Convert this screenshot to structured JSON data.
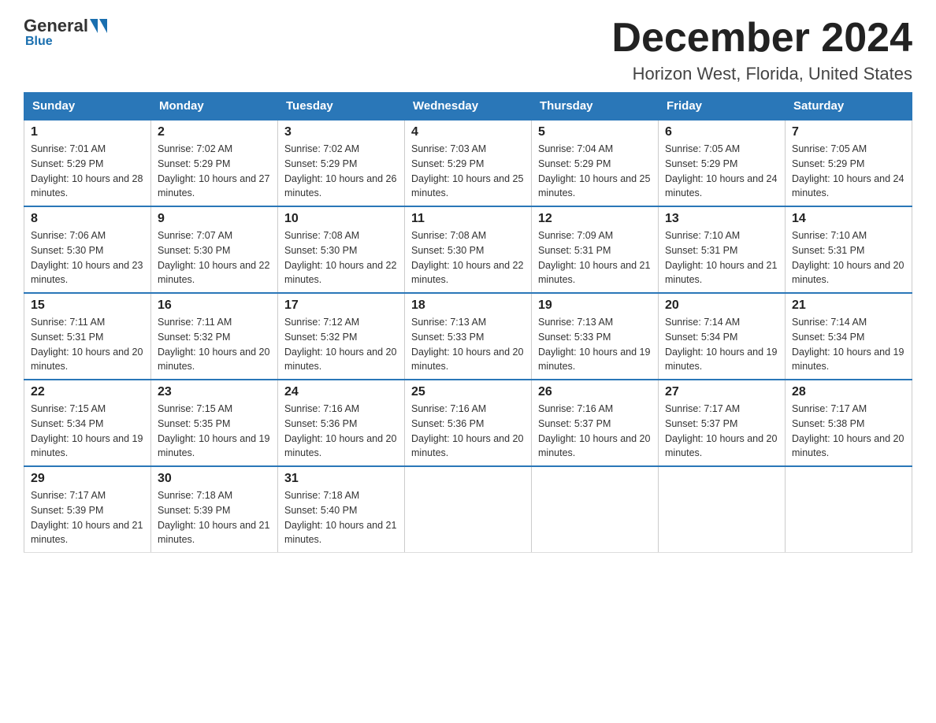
{
  "logo": {
    "general": "General",
    "blue": "Blue"
  },
  "header": {
    "month_year": "December 2024",
    "location": "Horizon West, Florida, United States"
  },
  "days_of_week": [
    "Sunday",
    "Monday",
    "Tuesday",
    "Wednesday",
    "Thursday",
    "Friday",
    "Saturday"
  ],
  "weeks": [
    [
      {
        "day": "1",
        "sunrise": "7:01 AM",
        "sunset": "5:29 PM",
        "daylight": "10 hours and 28 minutes."
      },
      {
        "day": "2",
        "sunrise": "7:02 AM",
        "sunset": "5:29 PM",
        "daylight": "10 hours and 27 minutes."
      },
      {
        "day": "3",
        "sunrise": "7:02 AM",
        "sunset": "5:29 PM",
        "daylight": "10 hours and 26 minutes."
      },
      {
        "day": "4",
        "sunrise": "7:03 AM",
        "sunset": "5:29 PM",
        "daylight": "10 hours and 25 minutes."
      },
      {
        "day": "5",
        "sunrise": "7:04 AM",
        "sunset": "5:29 PM",
        "daylight": "10 hours and 25 minutes."
      },
      {
        "day": "6",
        "sunrise": "7:05 AM",
        "sunset": "5:29 PM",
        "daylight": "10 hours and 24 minutes."
      },
      {
        "day": "7",
        "sunrise": "7:05 AM",
        "sunset": "5:29 PM",
        "daylight": "10 hours and 24 minutes."
      }
    ],
    [
      {
        "day": "8",
        "sunrise": "7:06 AM",
        "sunset": "5:30 PM",
        "daylight": "10 hours and 23 minutes."
      },
      {
        "day": "9",
        "sunrise": "7:07 AM",
        "sunset": "5:30 PM",
        "daylight": "10 hours and 22 minutes."
      },
      {
        "day": "10",
        "sunrise": "7:08 AM",
        "sunset": "5:30 PM",
        "daylight": "10 hours and 22 minutes."
      },
      {
        "day": "11",
        "sunrise": "7:08 AM",
        "sunset": "5:30 PM",
        "daylight": "10 hours and 22 minutes."
      },
      {
        "day": "12",
        "sunrise": "7:09 AM",
        "sunset": "5:31 PM",
        "daylight": "10 hours and 21 minutes."
      },
      {
        "day": "13",
        "sunrise": "7:10 AM",
        "sunset": "5:31 PM",
        "daylight": "10 hours and 21 minutes."
      },
      {
        "day": "14",
        "sunrise": "7:10 AM",
        "sunset": "5:31 PM",
        "daylight": "10 hours and 20 minutes."
      }
    ],
    [
      {
        "day": "15",
        "sunrise": "7:11 AM",
        "sunset": "5:31 PM",
        "daylight": "10 hours and 20 minutes."
      },
      {
        "day": "16",
        "sunrise": "7:11 AM",
        "sunset": "5:32 PM",
        "daylight": "10 hours and 20 minutes."
      },
      {
        "day": "17",
        "sunrise": "7:12 AM",
        "sunset": "5:32 PM",
        "daylight": "10 hours and 20 minutes."
      },
      {
        "day": "18",
        "sunrise": "7:13 AM",
        "sunset": "5:33 PM",
        "daylight": "10 hours and 20 minutes."
      },
      {
        "day": "19",
        "sunrise": "7:13 AM",
        "sunset": "5:33 PM",
        "daylight": "10 hours and 19 minutes."
      },
      {
        "day": "20",
        "sunrise": "7:14 AM",
        "sunset": "5:34 PM",
        "daylight": "10 hours and 19 minutes."
      },
      {
        "day": "21",
        "sunrise": "7:14 AM",
        "sunset": "5:34 PM",
        "daylight": "10 hours and 19 minutes."
      }
    ],
    [
      {
        "day": "22",
        "sunrise": "7:15 AM",
        "sunset": "5:34 PM",
        "daylight": "10 hours and 19 minutes."
      },
      {
        "day": "23",
        "sunrise": "7:15 AM",
        "sunset": "5:35 PM",
        "daylight": "10 hours and 19 minutes."
      },
      {
        "day": "24",
        "sunrise": "7:16 AM",
        "sunset": "5:36 PM",
        "daylight": "10 hours and 20 minutes."
      },
      {
        "day": "25",
        "sunrise": "7:16 AM",
        "sunset": "5:36 PM",
        "daylight": "10 hours and 20 minutes."
      },
      {
        "day": "26",
        "sunrise": "7:16 AM",
        "sunset": "5:37 PM",
        "daylight": "10 hours and 20 minutes."
      },
      {
        "day": "27",
        "sunrise": "7:17 AM",
        "sunset": "5:37 PM",
        "daylight": "10 hours and 20 minutes."
      },
      {
        "day": "28",
        "sunrise": "7:17 AM",
        "sunset": "5:38 PM",
        "daylight": "10 hours and 20 minutes."
      }
    ],
    [
      {
        "day": "29",
        "sunrise": "7:17 AM",
        "sunset": "5:39 PM",
        "daylight": "10 hours and 21 minutes."
      },
      {
        "day": "30",
        "sunrise": "7:18 AM",
        "sunset": "5:39 PM",
        "daylight": "10 hours and 21 minutes."
      },
      {
        "day": "31",
        "sunrise": "7:18 AM",
        "sunset": "5:40 PM",
        "daylight": "10 hours and 21 minutes."
      },
      null,
      null,
      null,
      null
    ]
  ],
  "labels": {
    "sunrise": "Sunrise:",
    "sunset": "Sunset:",
    "daylight": "Daylight:"
  }
}
